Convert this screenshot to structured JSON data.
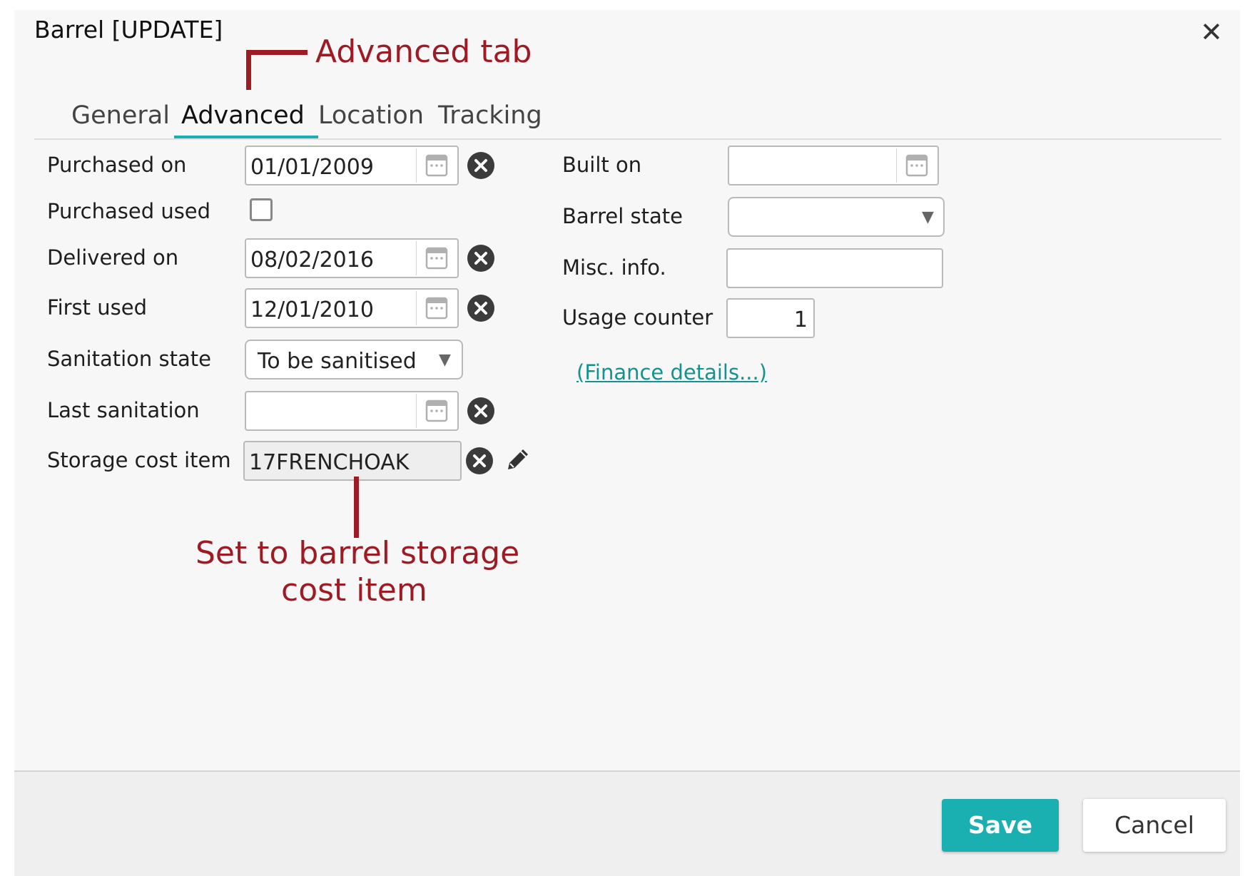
{
  "dialog": {
    "title": "Barrel [UPDATE]",
    "close_glyph": "✕"
  },
  "tabs": [
    {
      "label": "General"
    },
    {
      "label": "Advanced",
      "active": true
    },
    {
      "label": "Location"
    },
    {
      "label": "Tracking"
    }
  ],
  "left_form": {
    "purchased_on": {
      "label": "Purchased on",
      "value": "01/01/2009"
    },
    "purchased_used": {
      "label": "Purchased used",
      "checked": false
    },
    "delivered_on": {
      "label": "Delivered on",
      "value": "08/02/2016"
    },
    "first_used": {
      "label": "First used",
      "value": "12/01/2010"
    },
    "sanitation_state": {
      "label": "Sanitation state",
      "value": "To be sanitised"
    },
    "last_sanitation": {
      "label": "Last sanitation",
      "value": ""
    },
    "storage_cost_item": {
      "label": "Storage cost item",
      "value": "17FRENCHOAK"
    }
  },
  "right_form": {
    "built_on": {
      "label": "Built on",
      "value": ""
    },
    "barrel_state": {
      "label": "Barrel state",
      "value": ""
    },
    "misc_info": {
      "label": "Misc. info.",
      "value": ""
    },
    "usage_counter": {
      "label": "Usage counter",
      "value": "1"
    },
    "finance_link": "(Finance details...)"
  },
  "footer": {
    "save_label": "Save",
    "cancel_label": "Cancel"
  },
  "annotations": {
    "advanced_tab": "Advanced tab",
    "storage_line1": "Set to barrel storage",
    "storage_line2": "cost item"
  },
  "colors": {
    "accent": "#1aafb0",
    "annotation": "#9e1b24",
    "link": "#14928f"
  },
  "icons": {
    "calendar": "calendar-icon",
    "clear": "clear-circle-x-icon",
    "edit": "pencil-icon",
    "dropdown": "dropdown-arrow-icon",
    "close": "close-icon"
  }
}
